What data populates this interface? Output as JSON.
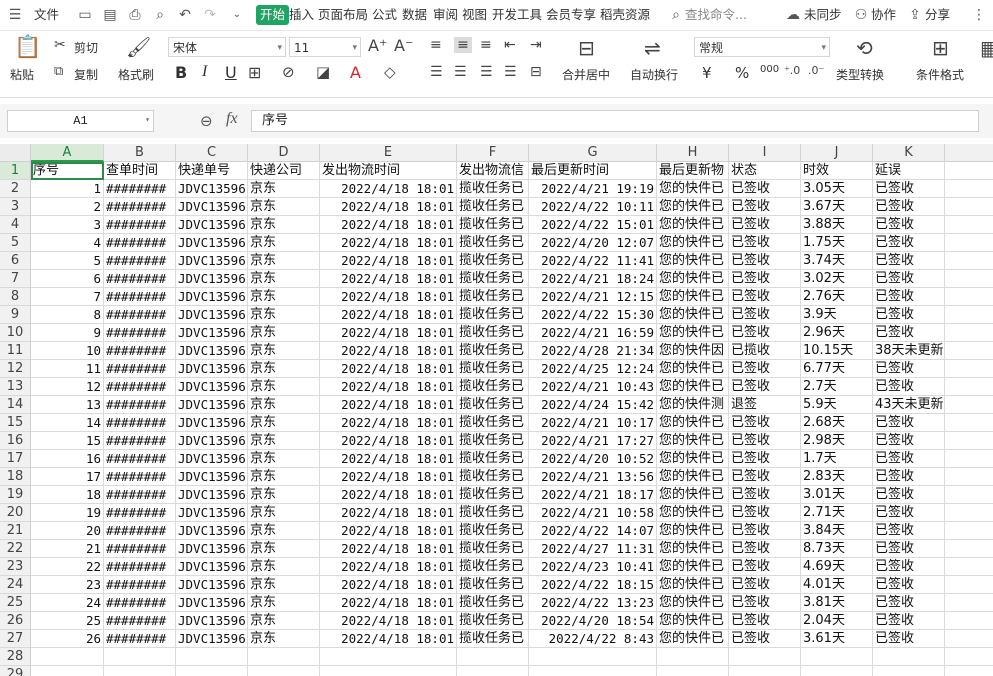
{
  "topbar": {
    "file": "文件",
    "tabs": [
      "开始",
      "插入",
      "页面布局",
      "公式",
      "数据",
      "审阅",
      "视图",
      "开发工具",
      "会员专享",
      "稻壳资源"
    ],
    "search_placeholder": "查找命令...",
    "unsynced": "未同步",
    "collab": "协作",
    "share": "分享"
  },
  "ribbon": {
    "paste": "粘贴",
    "cut": "剪切",
    "copy": "复制",
    "format_painter": "格式刷",
    "font_name": "宋体",
    "font_size": "11",
    "bold": "B",
    "italic": "I",
    "underline": "U",
    "merge_center": "合并居中",
    "wrap_text": "自动换行",
    "number_format": "常规",
    "currency": "¥",
    "percent": "%",
    "thousands": "000",
    "type_convert": "类型转换",
    "cond_format": "条件格式"
  },
  "formula_bar": {
    "cell_ref": "A1",
    "fx": "fx",
    "content": "序号"
  },
  "sheet": {
    "columns": [
      "A",
      "B",
      "C",
      "D",
      "E",
      "F",
      "G",
      "H",
      "I",
      "J",
      "K"
    ],
    "headers": [
      "序号",
      "查单时间",
      "快递单号",
      "快递公司",
      "发出物流时间",
      "发出物流信",
      "最后更新时间",
      "最后更新物",
      "状态",
      "时效",
      "延误"
    ],
    "rows": [
      [
        "1",
        "########",
        "JDVC13596",
        "京东",
        "2022/4/18 18:01",
        "揽收任务已",
        "2022/4/21 19:19",
        "您的快件已",
        "已签收",
        "3.05天",
        "已签收"
      ],
      [
        "2",
        "########",
        "JDVC13596",
        "京东",
        "2022/4/18 18:01",
        "揽收任务已",
        "2022/4/22 10:11",
        "您的快件已",
        "已签收",
        "3.67天",
        "已签收"
      ],
      [
        "3",
        "########",
        "JDVC13596",
        "京东",
        "2022/4/18 18:01",
        "揽收任务已",
        "2022/4/22 15:01",
        "您的快件已",
        "已签收",
        "3.88天",
        "已签收"
      ],
      [
        "4",
        "########",
        "JDVC13596",
        "京东",
        "2022/4/18 18:01",
        "揽收任务已",
        "2022/4/20 12:07",
        "您的快件已",
        "已签收",
        "1.75天",
        "已签收"
      ],
      [
        "5",
        "########",
        "JDVC13596",
        "京东",
        "2022/4/18 18:01",
        "揽收任务已",
        "2022/4/22 11:41",
        "您的快件已",
        "已签收",
        "3.74天",
        "已签收"
      ],
      [
        "6",
        "########",
        "JDVC13596",
        "京东",
        "2022/4/18 18:01",
        "揽收任务已",
        "2022/4/21 18:24",
        "您的快件已",
        "已签收",
        "3.02天",
        "已签收"
      ],
      [
        "7",
        "########",
        "JDVC13596",
        "京东",
        "2022/4/18 18:01",
        "揽收任务已",
        "2022/4/21 12:15",
        "您的快件已",
        "已签收",
        "2.76天",
        "已签收"
      ],
      [
        "8",
        "########",
        "JDVC13596",
        "京东",
        "2022/4/18 18:01",
        "揽收任务已",
        "2022/4/22 15:30",
        "您的快件已",
        "已签收",
        "3.9天",
        "已签收"
      ],
      [
        "9",
        "########",
        "JDVC13596",
        "京东",
        "2022/4/18 18:01",
        "揽收任务已",
        "2022/4/21 16:59",
        "您的快件已",
        "已签收",
        "2.96天",
        "已签收"
      ],
      [
        "10",
        "########",
        "JDVC13596",
        "京东",
        "2022/4/18 18:01",
        "揽收任务已",
        "2022/4/28 21:34",
        "您的快件因",
        "已揽收",
        "10.15天",
        "38天未更新"
      ],
      [
        "11",
        "########",
        "JDVC13596",
        "京东",
        "2022/4/18 18:01",
        "揽收任务已",
        "2022/4/25 12:24",
        "您的快件已",
        "已签收",
        "6.77天",
        "已签收"
      ],
      [
        "12",
        "########",
        "JDVC13596",
        "京东",
        "2022/4/18 18:01",
        "揽收任务已",
        "2022/4/21 10:43",
        "您的快件已",
        "已签收",
        "2.7天",
        "已签收"
      ],
      [
        "13",
        "########",
        "JDVC13596",
        "京东",
        "2022/4/18 18:01",
        "揽收任务已",
        "2022/4/24 15:42",
        "您的快件测",
        "退签",
        "5.9天",
        "43天未更新"
      ],
      [
        "14",
        "########",
        "JDVC13596",
        "京东",
        "2022/4/18 18:01",
        "揽收任务已",
        "2022/4/21 10:17",
        "您的快件已",
        "已签收",
        "2.68天",
        "已签收"
      ],
      [
        "15",
        "########",
        "JDVC13596",
        "京东",
        "2022/4/18 18:01",
        "揽收任务已",
        "2022/4/21 17:27",
        "您的快件已",
        "已签收",
        "2.98天",
        "已签收"
      ],
      [
        "16",
        "########",
        "JDVC13596",
        "京东",
        "2022/4/18 18:01",
        "揽收任务已",
        "2022/4/20 10:52",
        "您的快件已",
        "已签收",
        "1.7天",
        "已签收"
      ],
      [
        "17",
        "########",
        "JDVC13596",
        "京东",
        "2022/4/18 18:01",
        "揽收任务已",
        "2022/4/21 13:56",
        "您的快件已",
        "已签收",
        "2.83天",
        "已签收"
      ],
      [
        "18",
        "########",
        "JDVC13596",
        "京东",
        "2022/4/18 18:01",
        "揽收任务已",
        "2022/4/21 18:17",
        "您的快件已",
        "已签收",
        "3.01天",
        "已签收"
      ],
      [
        "19",
        "########",
        "JDVC13596",
        "京东",
        "2022/4/18 18:01",
        "揽收任务已",
        "2022/4/21 10:58",
        "您的快件已",
        "已签收",
        "2.71天",
        "已签收"
      ],
      [
        "20",
        "########",
        "JDVC13596",
        "京东",
        "2022/4/18 18:01",
        "揽收任务已",
        "2022/4/22 14:07",
        "您的快件已",
        "已签收",
        "3.84天",
        "已签收"
      ],
      [
        "21",
        "########",
        "JDVC13596",
        "京东",
        "2022/4/18 18:01",
        "揽收任务已",
        "2022/4/27 11:31",
        "您的快件已",
        "已签收",
        "8.73天",
        "已签收"
      ],
      [
        "22",
        "########",
        "JDVC13596",
        "京东",
        "2022/4/18 18:01",
        "揽收任务已",
        "2022/4/23 10:41",
        "您的快件已",
        "已签收",
        "4.69天",
        "已签收"
      ],
      [
        "23",
        "########",
        "JDVC13596",
        "京东",
        "2022/4/18 18:01",
        "揽收任务已",
        "2022/4/22 18:15",
        "您的快件已",
        "已签收",
        "4.01天",
        "已签收"
      ],
      [
        "24",
        "########",
        "JDVC13596",
        "京东",
        "2022/4/18 18:01",
        "揽收任务已",
        "2022/4/22 13:23",
        "您的快件已",
        "已签收",
        "3.81天",
        "已签收"
      ],
      [
        "25",
        "########",
        "JDVC13596",
        "京东",
        "2022/4/18 18:01",
        "揽收任务已",
        "2022/4/20 18:54",
        "您的快件已",
        "已签收",
        "2.04天",
        "已签收"
      ],
      [
        "26",
        "########",
        "JDVC13596",
        "京东",
        "2022/4/18 18:01",
        "揽收任务已",
        "2022/4/22 8:43",
        "您的快件已",
        "已签收",
        "3.61天",
        "已签收"
      ]
    ],
    "row_numbers": [
      "1",
      "2",
      "3",
      "4",
      "5",
      "6",
      "7",
      "8",
      "9",
      "10",
      "11",
      "12",
      "13",
      "14",
      "15",
      "16",
      "17",
      "18",
      "19",
      "20",
      "21",
      "22",
      "23",
      "24",
      "25",
      "26",
      "27",
      "28",
      "29"
    ]
  }
}
